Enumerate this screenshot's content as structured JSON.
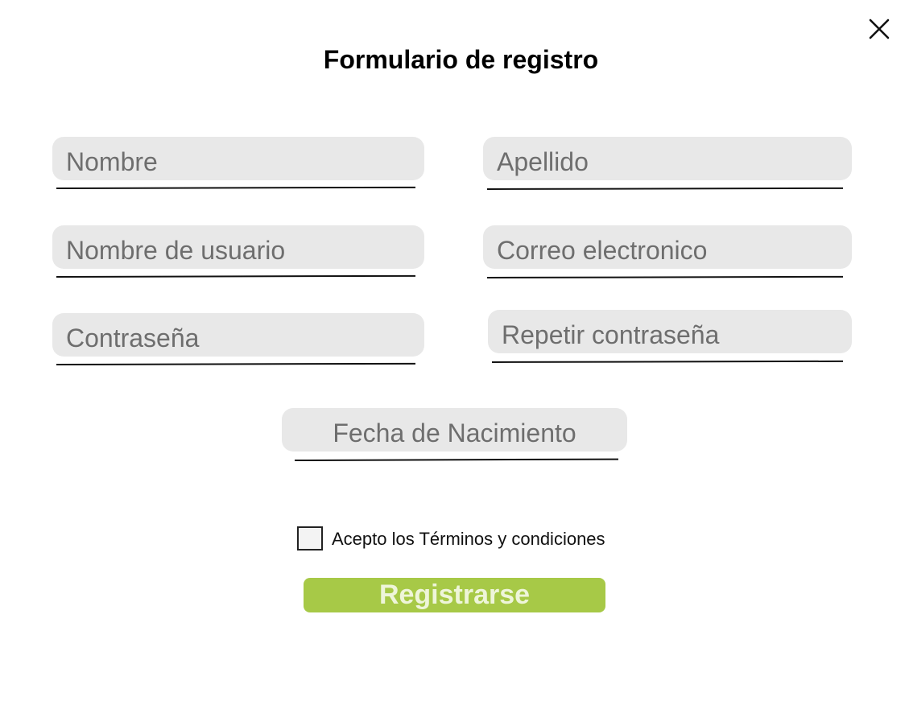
{
  "form": {
    "title": "Formulario de registro",
    "close_icon": "close-icon",
    "fields": {
      "first_name": {
        "placeholder": "Nombre",
        "value": ""
      },
      "last_name": {
        "placeholder": "Apellido",
        "value": ""
      },
      "username": {
        "placeholder": "Nombre de usuario",
        "value": ""
      },
      "email": {
        "placeholder": "Correo electronico",
        "value": ""
      },
      "password": {
        "placeholder": "Contraseña",
        "value": ""
      },
      "password_repeat": {
        "placeholder": "Repetir contraseña",
        "value": ""
      },
      "birth_date": {
        "placeholder": "Fecha de Nacimiento",
        "value": ""
      }
    },
    "terms": {
      "label": "Acepto los Términos y condiciones",
      "checked": false
    },
    "submit_label": "Registrarse"
  },
  "colors": {
    "field_background": "#e8e8e8",
    "placeholder_text": "#6e6e6e",
    "button_background": "#a7c947",
    "button_text": "#eef5d9"
  }
}
